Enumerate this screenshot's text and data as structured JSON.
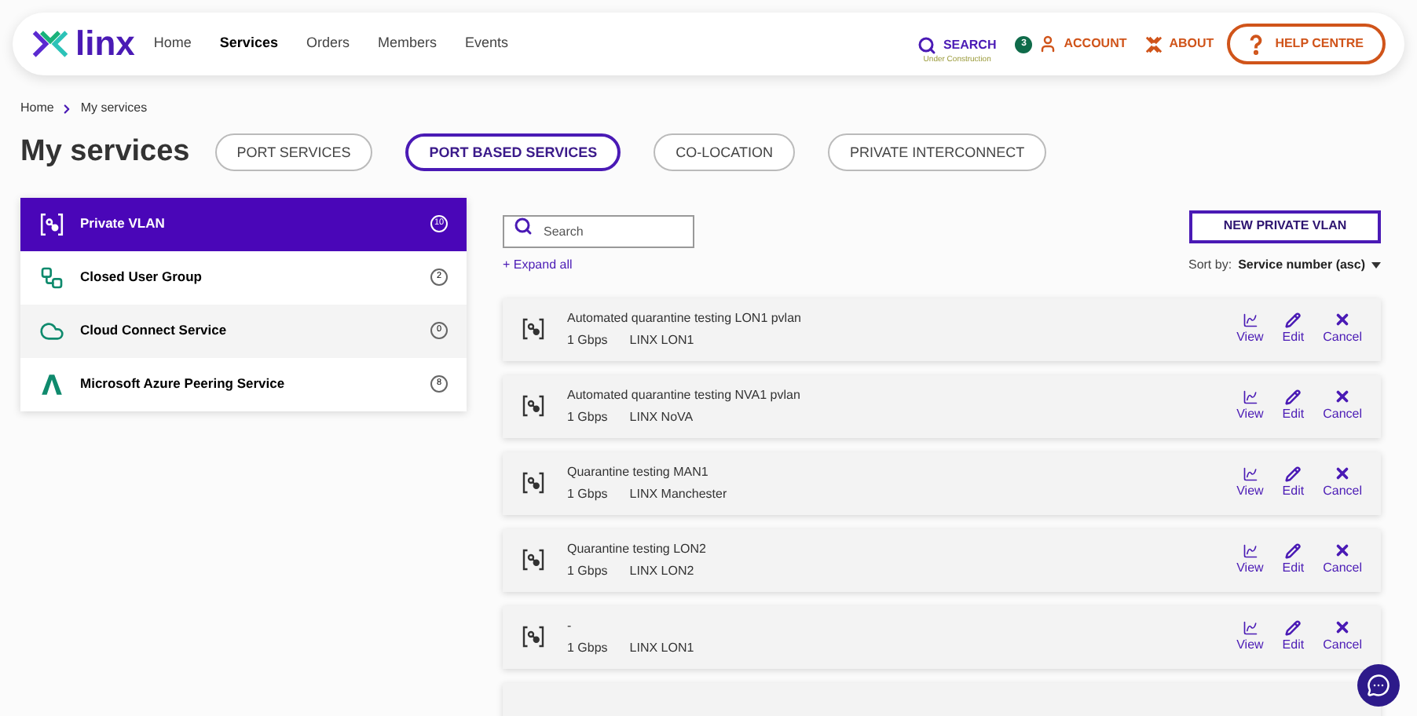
{
  "logo": "linx",
  "nav": {
    "items": [
      {
        "label": "Home",
        "selected": false
      },
      {
        "label": "Services",
        "selected": true
      },
      {
        "label": "Orders",
        "selected": false
      },
      {
        "label": "Members",
        "selected": false
      },
      {
        "label": "Events",
        "selected": false
      }
    ],
    "search": {
      "label": "SEARCH",
      "note": "Under Construction"
    },
    "account": {
      "badge": "3",
      "label": "ACCOUNT"
    },
    "about": "ABOUT",
    "help": "HELP CENTRE"
  },
  "breadcrumb": [
    "Home",
    "My services"
  ],
  "title": "My services",
  "tabs": [
    {
      "label": "PORT SERVICES",
      "selected": false
    },
    {
      "label": "PORT BASED SERVICES",
      "selected": true
    },
    {
      "label": "CO-LOCATION",
      "selected": false
    },
    {
      "label": "PRIVATE INTERCONNECT",
      "selected": false
    }
  ],
  "sidebar": {
    "items": [
      {
        "kind": "vlan",
        "label": "Private VLAN",
        "count": "10",
        "selected": true
      },
      {
        "kind": "group",
        "label": "Closed User Group",
        "count": "2",
        "selected": false
      },
      {
        "kind": "cloud",
        "label": "Cloud Connect Service",
        "count": "0",
        "selected": false
      },
      {
        "kind": "azure",
        "label": "Microsoft Azure Peering Service",
        "count": "8",
        "selected": false
      }
    ]
  },
  "search": {
    "placeholder": "Search"
  },
  "new_button": "NEW PRIVATE VLAN",
  "expand_all": "+ Expand all",
  "sort": {
    "label": "Sort by:",
    "value": "Service number (asc)"
  },
  "services": [
    {
      "name": "Automated quarantine testing LON1 pvlan",
      "speed": "1 Gbps",
      "location": "LINX LON1",
      "actions": [
        "View",
        "Edit",
        "Cancel"
      ]
    },
    {
      "name": "Automated quarantine testing NVA1 pvlan",
      "speed": "1 Gbps",
      "location": "LINX NoVA",
      "actions": [
        "View",
        "Edit",
        "Cancel"
      ]
    },
    {
      "name": "Quarantine testing MAN1",
      "speed": "1 Gbps",
      "location": "LINX Manchester",
      "actions": [
        "View",
        "Edit",
        "Cancel"
      ]
    },
    {
      "name": "Quarantine testing LON2",
      "speed": "1 Gbps",
      "location": "LINX LON2",
      "actions": [
        "View",
        "Edit",
        "Cancel"
      ]
    },
    {
      "name": "-",
      "speed": "1 Gbps",
      "location": "LINX LON1",
      "actions": [
        "View",
        "Edit",
        "Cancel"
      ]
    }
  ]
}
